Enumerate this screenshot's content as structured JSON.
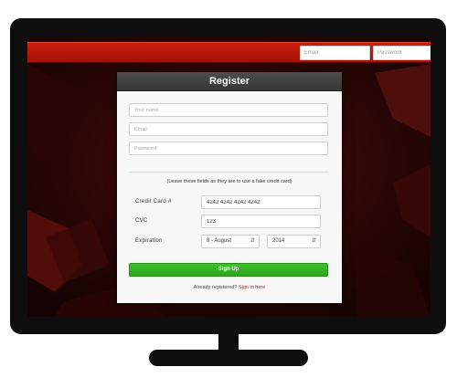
{
  "header": {
    "email_placeholder": "Email",
    "password_placeholder": "Password"
  },
  "register": {
    "title": "Register",
    "name_placeholder": "Your name",
    "email_placeholder": "Email",
    "password_placeholder": "Password",
    "note": "(Leave these fields as they are to use a fake credit card)",
    "card_label": "Credit Card #",
    "card_value": "4242 4242 4242 4242",
    "cvc_label": "CVC",
    "cvc_value": "123",
    "expiration_label": "Expiration",
    "month_value": "8 - August",
    "year_value": "2014",
    "signup_label": "Sign Up",
    "already_text": "Already registered?",
    "signin_link": "Sign in here"
  },
  "icons": {
    "select_arrow": "up-down-arrows-icon"
  },
  "colors": {
    "topbar": "#b8170b",
    "signup_button": "#34b322",
    "signin_link": "#c01818",
    "panel_header": "#404040"
  }
}
